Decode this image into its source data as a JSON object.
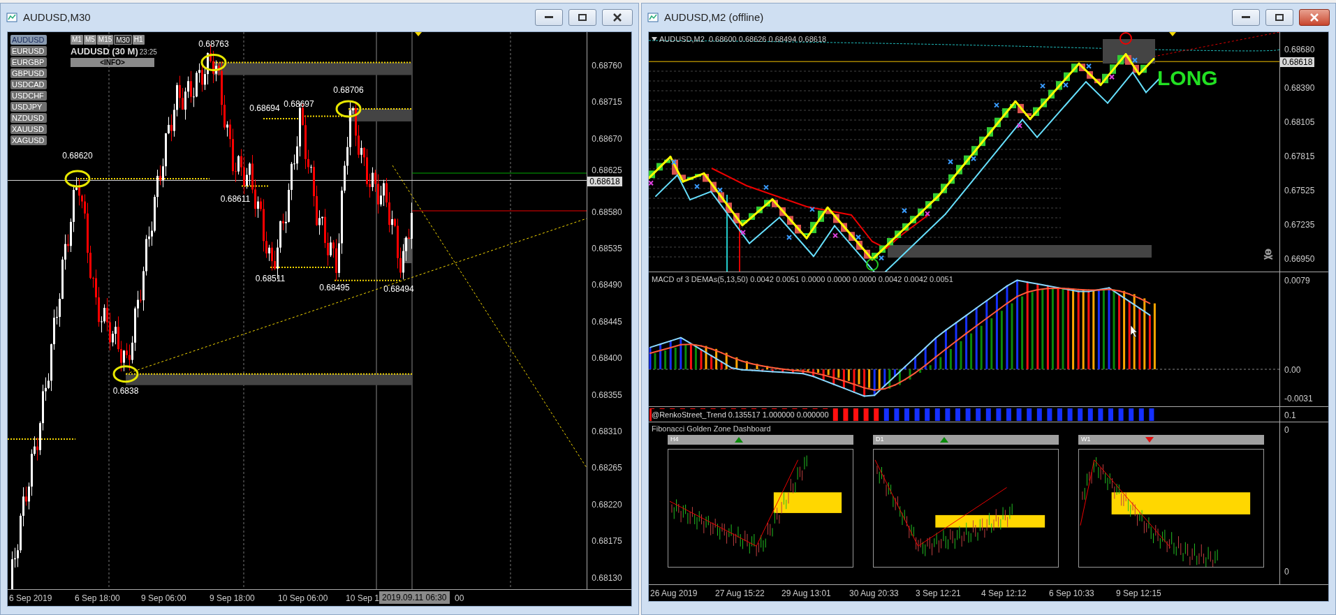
{
  "left_window": {
    "title": "AUDUSD,M30",
    "active": false,
    "symbols": [
      {
        "label": "AUDUSD",
        "selected": true
      },
      {
        "label": "EURUSD",
        "selected": false
      },
      {
        "label": "EURGBP",
        "selected": false
      },
      {
        "label": "GBPUSD",
        "selected": false
      },
      {
        "label": "USDCAD",
        "selected": false
      },
      {
        "label": "USDCHF",
        "selected": false
      },
      {
        "label": "USDJPY",
        "selected": false
      },
      {
        "label": "NZDUSD",
        "selected": false
      },
      {
        "label": "XAUUSD",
        "selected": false
      },
      {
        "label": "XAGUSD",
        "selected": false
      }
    ],
    "timeframes": [
      {
        "label": "M1",
        "selected": false
      },
      {
        "label": "M5",
        "selected": false
      },
      {
        "label": "M15",
        "selected": false
      },
      {
        "label": "M30",
        "selected": true
      },
      {
        "label": "H1",
        "selected": false
      }
    ],
    "panel_title": "AUDUSD (30 M)",
    "timer": "23:25",
    "info_button": "<INFO>",
    "price_labels": [
      "0.68620",
      "0.68763",
      "0.68694",
      "0.68697",
      "0.68706",
      "0.68611",
      "0.68511",
      "0.68495",
      "0.68494",
      "0.6838"
    ],
    "price_axis": [
      "0.68760",
      "0.68715",
      "0.68670",
      "0.68625",
      "0.68580",
      "0.68535",
      "0.68490",
      "0.68445",
      "0.68400",
      "0.68355",
      "0.68310",
      "0.68265",
      "0.68220",
      "0.68175",
      "0.68130"
    ],
    "current_price": "0.68618",
    "time_axis": [
      "6 Sep 2019",
      "6 Sep 18:00",
      "9 Sep 06:00",
      "9 Sep 18:00",
      "10 Sep 06:00",
      "10 Sep 1"
    ],
    "time_badge": "2019.09.11 06:30",
    "time_tail": "00"
  },
  "right_window": {
    "title": "AUDUSD,M2 (offline)",
    "active": true,
    "chart_header": "AUDUSD,M2  0.68600 0.68626 0.68494 0.68618",
    "signal": "LONG",
    "price_axis": [
      "0.68680",
      "0.68390",
      "0.68105",
      "0.67815",
      "0.67525",
      "0.67235",
      "0.66950"
    ],
    "current_price": "0.68618",
    "macd": {
      "header": "MACD of 3 DEMAs(5,13,50) 0.0042 0.0051 0.0000 0.0000 0.0000 0.0042 0.0042 0.0051",
      "axis": [
        "0.0079",
        "0.00",
        "-0.0031"
      ]
    },
    "trend": {
      "header": "@RenkoStreet_Trend 0.135517 1.000000 0.000000",
      "axis": "0.1"
    },
    "fib_dashboard": {
      "title": "Fibonacci Golden Zone Dashboard",
      "axis": [
        "0",
        "0"
      ],
      "panels": [
        {
          "label": "H4",
          "trend_up": true
        },
        {
          "label": "D1",
          "trend_up": true
        },
        {
          "label": "W1",
          "trend_up": false
        }
      ]
    },
    "time_axis": [
      "26 Aug 2019",
      "27 Aug 15:22",
      "29 Aug 13:01",
      "30 Aug 20:33",
      "3 Sep 12:21",
      "4 Sep 12:12",
      "6 Sep 10:33",
      "9 Sep 12:15"
    ]
  }
}
